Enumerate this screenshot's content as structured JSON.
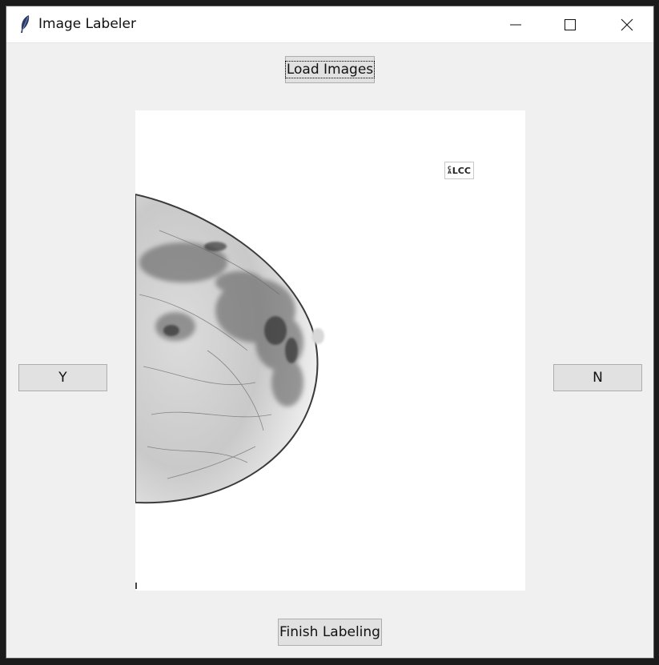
{
  "window": {
    "title": "Image Labeler"
  },
  "buttons": {
    "load": "Load Images",
    "yes": "Y",
    "no": "N",
    "finish": "Finish Labeling"
  },
  "image": {
    "view_label": "LCC",
    "view_label_prefix_top": "C",
    "view_label_prefix_bottom": "A"
  },
  "icons": {
    "app": "feather-icon",
    "minimize": "minimize-icon",
    "maximize": "maximize-icon",
    "close": "close-icon"
  }
}
